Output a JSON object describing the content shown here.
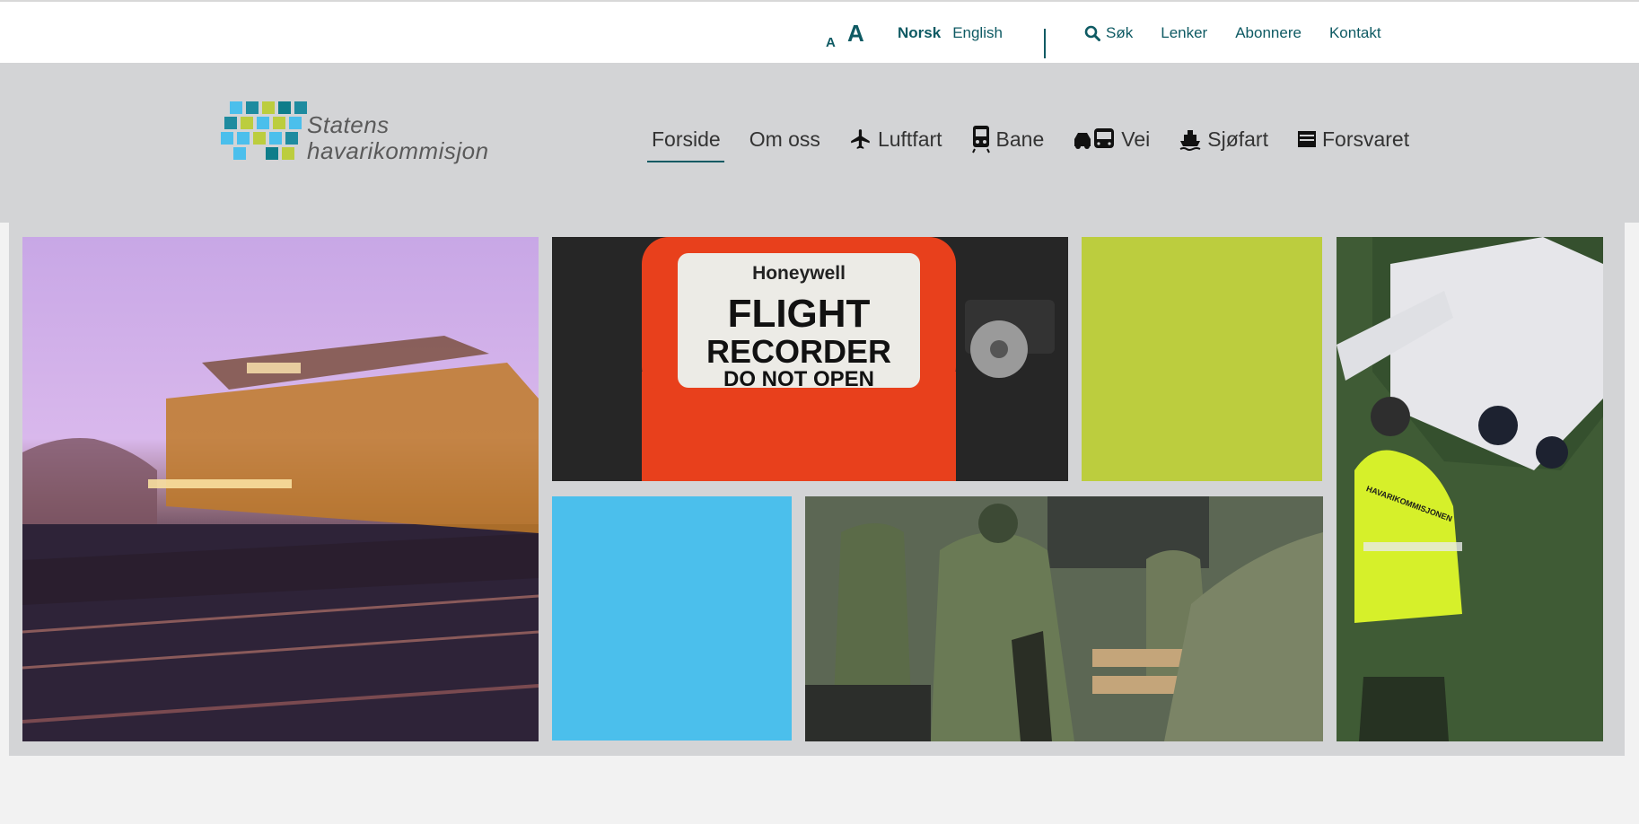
{
  "util_bar": {
    "font_small": "A",
    "font_large": "A",
    "languages": [
      "Norsk",
      "English"
    ],
    "active_language": "Norsk",
    "search_label": "Søk",
    "links": [
      "Lenker",
      "Abonnere",
      "Kontakt"
    ]
  },
  "logo": {
    "line1": "Statens",
    "line2": "havarikommisjon"
  },
  "main_nav": [
    {
      "label": "Forside",
      "icon": "none",
      "active": true
    },
    {
      "label": "Om oss",
      "icon": "none",
      "active": false
    },
    {
      "label": "Luftfart",
      "icon": "airplane-icon",
      "active": false
    },
    {
      "label": "Bane",
      "icon": "train-icon",
      "active": false
    },
    {
      "label": "Vei",
      "icon": "car-bus-icon",
      "active": false
    },
    {
      "label": "Sjøfart",
      "icon": "ship-icon",
      "active": false
    },
    {
      "label": "Forsvaret",
      "icon": "military-icon",
      "active": false
    }
  ],
  "recorder_photo": {
    "brand": "Honeywell",
    "line1": "FLIGHT",
    "line2": "RECORDER",
    "line3": "DO NOT OPEN"
  },
  "plane_photo": {
    "jacket_text": "HAVARIKOMMISJONEN"
  },
  "colors": {
    "accent": "#0e5a63",
    "header_bg": "#d3d4d6",
    "tile_green": "#bccd3e",
    "tile_blue": "#4bbfec",
    "recorder_orange": "#e8401c"
  }
}
